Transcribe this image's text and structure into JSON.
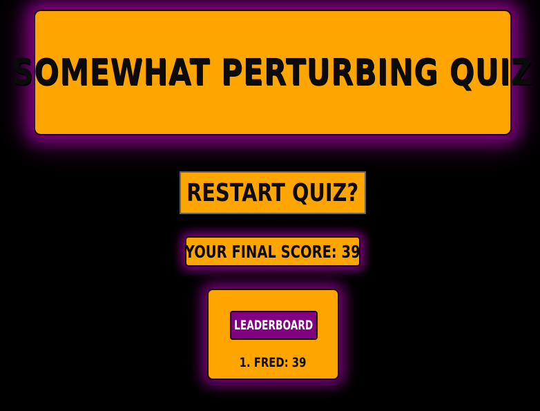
{
  "header": {
    "title": "SOMEWHAT PERTURBING QUIZ"
  },
  "actions": {
    "restart_label": "RESTART QUIZ?"
  },
  "score": {
    "label": "YOUR FINAL SCORE: 39"
  },
  "leaderboard": {
    "button_label": "LEADERBOARD",
    "entries": [
      {
        "text": "1. FRED: 39"
      }
    ]
  },
  "colors": {
    "background": "#000000",
    "panel": "#ffa500",
    "glow": "#7a007a",
    "button": "#800080",
    "text_dark": "#0b0b0b",
    "text_light": "#ffffff"
  }
}
